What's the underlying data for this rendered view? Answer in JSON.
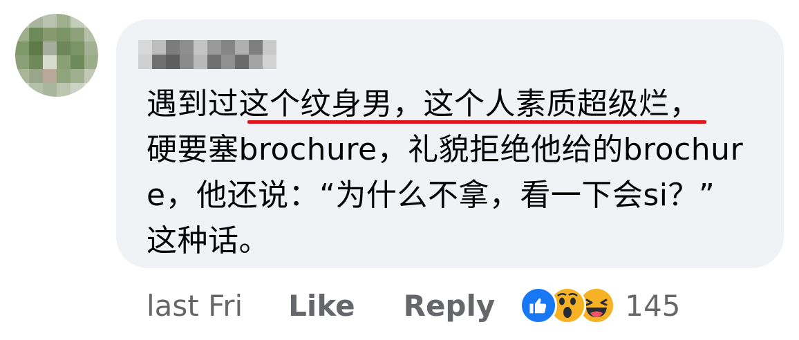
{
  "comment": {
    "lines": [
      {
        "before": "遇到过",
        "highlight": "这个纹身男，这个人素质超级烂",
        "after": "，"
      },
      {
        "text": "硬要塞brochure，礼貌拒绝他给的brochur"
      },
      {
        "text": "e，他还说：“为什么不拿，看一下会si？”"
      },
      {
        "text": "这种话。"
      }
    ],
    "underline_color": "#e0151b"
  },
  "footer": {
    "time": "last Fri",
    "like_label": "Like",
    "reply_label": "Reply",
    "reaction_icons": [
      "like-icon",
      "wow-icon",
      "haha-icon"
    ],
    "reaction_count": "145"
  },
  "colors": {
    "bubble": "#f0f2f5",
    "text": "#050505",
    "secondary": "#65676b",
    "like_blue": "#1877f2",
    "emoji_yellow": "#f7b125"
  }
}
